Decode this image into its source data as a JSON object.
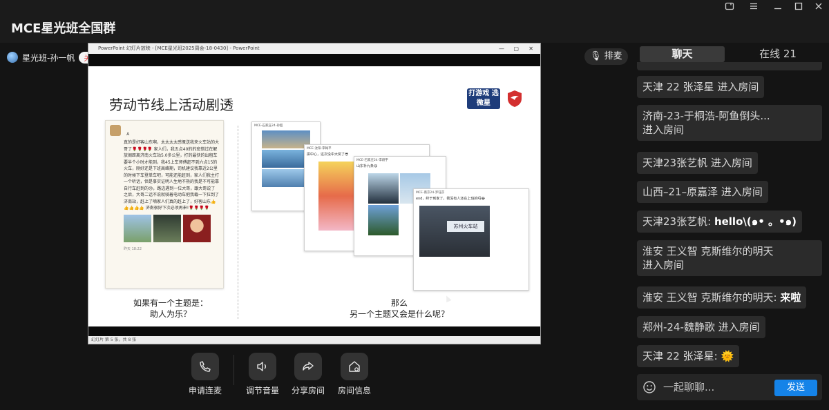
{
  "app": {
    "title": "MCE星光班全国群"
  },
  "window_controls": [
    "screen-icon",
    "menu-icon",
    "minimize-icon",
    "maximize-icon",
    "close-icon"
  ],
  "host": {
    "name": "星光班-孙一帆",
    "follow_label": "关注"
  },
  "queue_label": "排麦",
  "ppt": {
    "window_title": "PowerPoint 幻灯片放映 - [MCE星光班2025周会-18-0430] - PowerPoint",
    "status": "幻灯片 第 5 张，共 8 张",
    "slide": {
      "title": "劳动节线上活动剧透",
      "logo_text": "打游戏 选微星",
      "note": {
        "author": "A",
        "text": "真的是好客山东啊，太太太太感慨送我来火车站的大哥了🌹🌹🌹🌹 家人们，我五点40的的班错过在解放阁距离济南火车站5.0多公里，打的最快的出租车要半个小时才能到，我45上车师傅赶不到六点15的火车，刚好还是下班高峰期，司机建议我靠近2公里的时候下车登单车吧，可能还能赶到，家人们我主打一个听话，但是事实证明人生地不熟的我是不可能靠自行车赶到的😓，路边遇到一位大哥，跟大哥说了之后，大哥二话不说就骑着电动车把我载一下拉到了济南站，赶上了嘀家人们真的赶上了，好客山东👍👍👍👍👍 济南很好下次必须再来!🌹🌹🌹🌹",
        "time": "昨天 18:22"
      },
      "left_caption": [
        "如果有一个主题是：",
        "助人为乐？"
      ],
      "right_caption": [
        "那么",
        "另一个主题又会是什么呢？"
      ],
      "shots": [
        {
          "head": "MCE-石家庄24-孙超",
          "text": ""
        },
        {
          "head": "MCE-沈阳-李翰平",
          "text": "拼中心，这次没中大奖了😎"
        },
        {
          "head": "MCE-石家庄24-李翔宇",
          "text": "山东补九条😋"
        },
        {
          "head": "MCE-南京24-罗钰莎",
          "text": "end，终于到家了，我没有人还在上班的吗😂"
        }
      ],
      "station_sign": "苏州火车站"
    }
  },
  "controls": [
    {
      "label": "申请连麦",
      "icon": "phone-icon"
    },
    {
      "label": "调节音量",
      "icon": "volume-icon"
    },
    {
      "label": "分享房间",
      "icon": "share-icon"
    },
    {
      "label": "房间信息",
      "icon": "room-info-icon"
    }
  ],
  "panel": {
    "tabs": {
      "chat": "聊天",
      "online": "在线 21"
    },
    "messages": [
      {
        "text": "天津 22 张泽星 进入房间"
      },
      {
        "text": "济南-23-于桐浩-阿鱼倒头...\n进入房间"
      },
      {
        "text": "天津23张艺帆 进入房间"
      },
      {
        "text": "山西–21–原嘉泽 进入房间"
      },
      {
        "sender": "天津23张艺帆:",
        "content": "hello\\(๑• 。•๑)"
      },
      {
        "text": "淮安 王义智 克斯维尔的明天\n进入房间"
      },
      {
        "sender": "淮安 王义智 克斯维尔的明天:",
        "content": "来啦"
      },
      {
        "text": "郑州-24-魏静歌 进入房间"
      },
      {
        "sender": "天津 22 张泽星:",
        "content": "🌞"
      }
    ],
    "input_placeholder": "一起聊聊...",
    "send_label": "发送"
  }
}
